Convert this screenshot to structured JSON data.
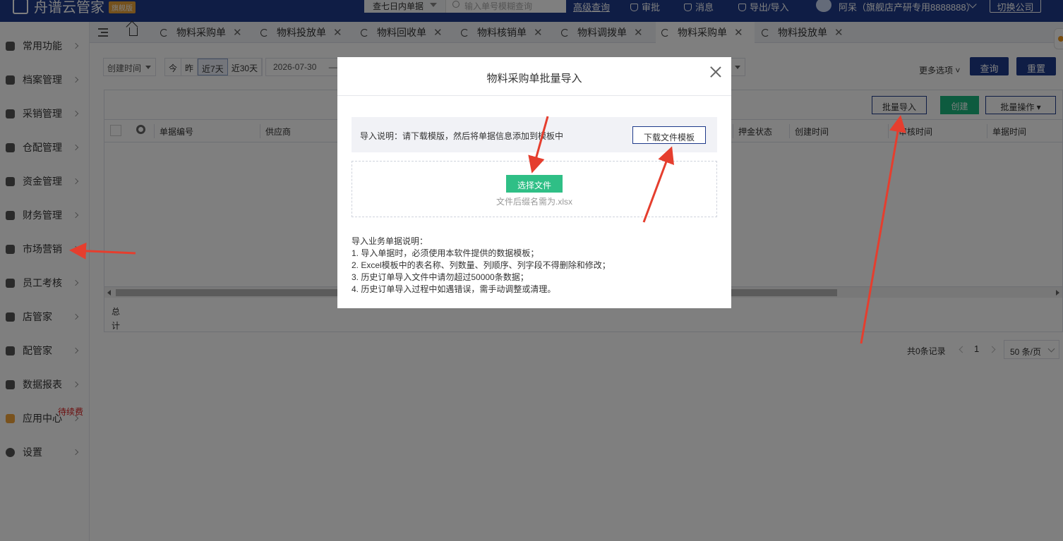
{
  "topbar": {
    "app_name": "舟谱云管家",
    "edition_badge": "旗舰版",
    "query_range": "查七日内单据",
    "search_placeholder": "输入单号模糊查询",
    "advanced_query": "高级查询",
    "approval": "审批",
    "messages": "消息",
    "import_export": "导出/导入",
    "user": "阿呆（旗舰店产研专用8888888）",
    "switch_company": "切换公司"
  },
  "sidebar": {
    "items": [
      {
        "label": "常用功能",
        "icon": "star-icon"
      },
      {
        "label": "档案管理",
        "icon": "grid-icon"
      },
      {
        "label": "采销管理",
        "icon": "clipboard-icon"
      },
      {
        "label": "仓配管理",
        "icon": "warehouse-icon"
      },
      {
        "label": "资金管理",
        "icon": "money-bag-icon"
      },
      {
        "label": "财务管理",
        "icon": "calculator-icon"
      },
      {
        "label": "市场营销",
        "icon": "store-icon"
      },
      {
        "label": "员工考核",
        "icon": "people-icon"
      },
      {
        "label": "店管家",
        "icon": "shop-icon"
      },
      {
        "label": "配管家",
        "icon": "chat-icon"
      },
      {
        "label": "数据报表",
        "icon": "chart-icon"
      },
      {
        "label": "应用中心",
        "icon": "apps-icon"
      },
      {
        "label": "设置",
        "icon": "gear-icon"
      }
    ],
    "app_center_badge": "待续费"
  },
  "tabs": [
    {
      "label": "物料采购单"
    },
    {
      "label": "物料投放单"
    },
    {
      "label": "物料回收单"
    },
    {
      "label": "物料核销单"
    },
    {
      "label": "物料调拨单"
    },
    {
      "label": "物料采购单",
      "active": true
    },
    {
      "label": "物料投放单"
    }
  ],
  "filters": {
    "date_field": "创建时间",
    "quick": [
      "今",
      "昨",
      "近7天",
      "近30天"
    ],
    "quick_active": "近7天",
    "start_date": "2026-07-30",
    "range_dash": "—",
    "more_options": "更多选项",
    "query": "查询",
    "reset": "重置"
  },
  "grid": {
    "batch_import": "批量导入",
    "create": "创建",
    "batch_ops": "批量操作",
    "columns": [
      "单据编号",
      "供应商",
      "押金状态",
      "创建时间",
      "审核时间",
      "单据时间"
    ],
    "total_label": "总计"
  },
  "pagination": {
    "count": "共0条记录",
    "page": "1",
    "page_size": "50 条/页"
  },
  "modal": {
    "title": "物料采购单批量导入",
    "notice": "导入说明：请下载模版，然后将单据信息添加到模板中",
    "download_template": "下载文件模板",
    "choose_file": "选择文件",
    "file_hint": "文件后缀名需为.xlsx",
    "instructions_title": "导入业务单据说明：",
    "instructions": [
      "1. 导入单据时，必须使用本软件提供的数据模板；",
      "2. Excel模板中的表名称、列数量、列顺序、列字段不得删除和修改；",
      "3. 历史订单导入文件中请勿超过50000条数据；",
      "4. 历史订单导入过程中如遇错误，需手动调整或清理。"
    ]
  },
  "colors": {
    "nav": "#1e3a8a",
    "green": "#1bb77e",
    "annotation_red": "#e53e2e"
  }
}
